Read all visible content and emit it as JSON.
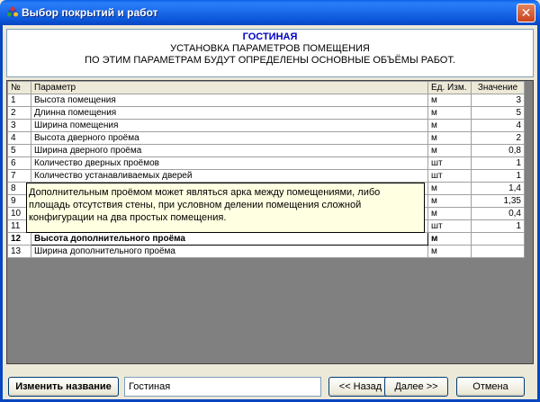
{
  "window": {
    "title": "Выбор покрытий и работ",
    "close_label": "✕"
  },
  "header": {
    "room_name": "ГОСТИНАЯ",
    "line1": "УСТАНОВКА ПАРАМЕТРОВ ПОМЕЩЕНИЯ",
    "line2": "ПО ЭТИМ ПАРАМЕТРАМ БУДУТ ОПРЕДЕЛЕНЫ ОСНОВНЫЕ ОБЪЁМЫ РАБОТ."
  },
  "grid": {
    "columns": {
      "num": "№",
      "param": "Параметр",
      "unit": "Ед. Изм.",
      "value": "Значение"
    },
    "rows": [
      {
        "num": "1",
        "param": "Высота помещения",
        "unit": "м",
        "value": "3"
      },
      {
        "num": "2",
        "param": "Длинна помещения",
        "unit": "м",
        "value": "5"
      },
      {
        "num": "3",
        "param": "Ширина помещения",
        "unit": "м",
        "value": "4"
      },
      {
        "num": "4",
        "param": "Высота дверного проёма",
        "unit": "м",
        "value": "2"
      },
      {
        "num": "5",
        "param": "Ширина дверного проёма",
        "unit": "м",
        "value": "0,8"
      },
      {
        "num": "6",
        "param": "Количество дверных проёмов",
        "unit": "шт",
        "value": "1"
      },
      {
        "num": "7",
        "param": "Количество устанавливаемых дверей",
        "unit": "шт",
        "value": "1"
      },
      {
        "num": "8",
        "param": "",
        "unit": "м",
        "value": "1,4"
      },
      {
        "num": "9",
        "param": "",
        "unit": "м",
        "value": "1,35"
      },
      {
        "num": "10",
        "param": "",
        "unit": "м",
        "value": "0,4"
      },
      {
        "num": "11",
        "param": "",
        "unit": "шт",
        "value": "1"
      },
      {
        "num": "12",
        "param": "Высота дополнительного проёма",
        "unit": "м",
        "value": ""
      },
      {
        "num": "13",
        "param": "Ширина дополнительного проёма",
        "unit": "м",
        "value": ""
      }
    ],
    "tooltip": "Дополнительным проёмом может являться арка между помещениями, либо площадь отсутствия стены, при условном делении помещения сложной конфигурации на два простых помещения."
  },
  "footer": {
    "rename_button": "Изменить название",
    "name_value": "Гостиная",
    "back_button": "<< Назад",
    "next_button": "Далее >>",
    "cancel_button": "Отмена"
  },
  "colors": {
    "title_bar": "#0A5FE6",
    "header_room": "#0000C0",
    "grid_background": "#808080",
    "tooltip_background": "#FFFFE1"
  }
}
